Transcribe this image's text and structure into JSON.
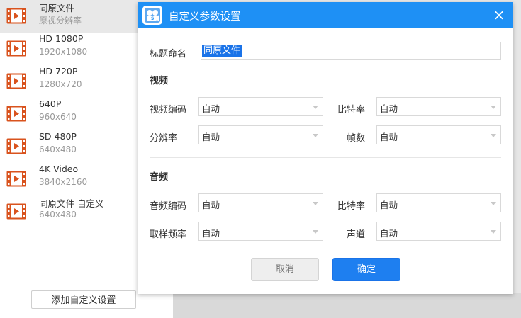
{
  "presets": [
    {
      "name": "同原文件",
      "res": "原视分辨率",
      "selected": true
    },
    {
      "name": "HD 1080P",
      "res": "1920x1080",
      "selected": false
    },
    {
      "name": "HD 720P",
      "res": "1280x720",
      "selected": false
    },
    {
      "name": "640P",
      "res": "960x640",
      "selected": false
    },
    {
      "name": "SD 480P",
      "res": "640x480",
      "selected": false
    },
    {
      "name": "4K Video",
      "res": "3840x2160",
      "selected": false
    },
    {
      "name": "同原文件 自定义",
      "res": "640x480",
      "selected": false
    }
  ],
  "add_custom_label": "添加自定义设置",
  "dialog": {
    "title": "自定义参数设置",
    "close_icon": "×",
    "title_name_label": "标题命名",
    "title_name_value": "同原文件",
    "video_section": "视频",
    "audio_section": "音频",
    "video_codec_label": "视频编码",
    "video_codec_value": "自动",
    "video_bitrate_label": "比特率",
    "video_bitrate_value": "自动",
    "resolution_label": "分辨率",
    "resolution_value": "自动",
    "framerate_label": "帧数",
    "framerate_value": "自动",
    "audio_codec_label": "音频编码",
    "audio_codec_value": "自动",
    "audio_bitrate_label": "比特率",
    "audio_bitrate_value": "自动",
    "sample_rate_label": "取样频率",
    "sample_rate_value": "自动",
    "channel_label": "声道",
    "channel_value": "自动",
    "cancel_label": "取消",
    "ok_label": "确定"
  },
  "colors": {
    "header_blue": "#1e90f5",
    "icon_orange": "#d9531e",
    "ok_button": "#1e7ff0"
  },
  "icons": {
    "preset_icon": "film-icon",
    "dialog_logo": "video-camera-logo-icon"
  }
}
